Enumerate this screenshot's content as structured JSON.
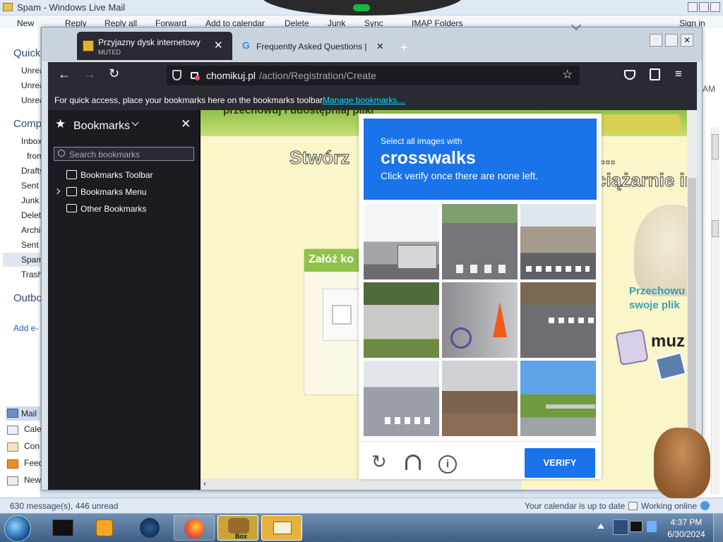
{
  "wlmail": {
    "title": "Spam - Windows Live Mail",
    "toolbar": [
      "New",
      "Reply",
      "Reply all",
      "Forward",
      "Add to calendar",
      "Delete",
      "Junk",
      "Sync",
      "IMAP Folders",
      "Sign in"
    ],
    "quick_header": "Quick",
    "quick_items": [
      "Unrea",
      "Unrea",
      "Unrea"
    ],
    "comp_header": "Comp",
    "folders": [
      "Inbox",
      "from",
      "Drafts",
      "Sent",
      "Junk",
      "Delet",
      "Archi",
      "Sent",
      "Spam",
      "Trash"
    ],
    "outbox": "Outbo",
    "add_email": "Add e-",
    "nav_items": [
      "Mail",
      "Cale",
      "Con",
      "Feed",
      "New"
    ],
    "right_text": "AM",
    "status_left": "630 message(s), 446 unread",
    "status_calendar": "Your calendar is up to date",
    "status_online": "Working online"
  },
  "firefox": {
    "tabs": [
      {
        "title": "Przyjazny dysk internetowy - C",
        "sub": "MUTED"
      },
      {
        "title": "Frequently Asked Questions  |  ("
      }
    ],
    "new_tab": "+",
    "url": {
      "host": "chomikuj.pl",
      "path": "/action/Registration/Create"
    },
    "bookmarks_bar_text": "For quick access, place your bookmarks here on the bookmarks toolbar.",
    "bookmarks_bar_link": "Manage bookmarks…",
    "sidebar": {
      "title": "Bookmarks",
      "search_placeholder": "Search bookmarks",
      "items": [
        "Bookmarks Toolbar",
        "Bookmarks Menu",
        "Other Bookmarks"
      ]
    }
  },
  "page": {
    "banner_text": "przechowuj i udostępniaj pliki",
    "heading_left": "Stwórz",
    "heading_right": "ciążarnie in",
    "heading_dots": "...",
    "panel_title": "Załóż ko",
    "side_text_1": "Przechowu",
    "side_text_2": "swoje plik",
    "side_text_3": "muz"
  },
  "captcha": {
    "prompt": "Select all images with",
    "target": "crosswalks",
    "instruction": "Click verify once there are none left.",
    "verify_label": "VERIFY",
    "header_color": "#1a73e8"
  },
  "taskbar": {
    "time": "4:37 PM",
    "date": "6/30/2024",
    "box_label": "Box"
  }
}
